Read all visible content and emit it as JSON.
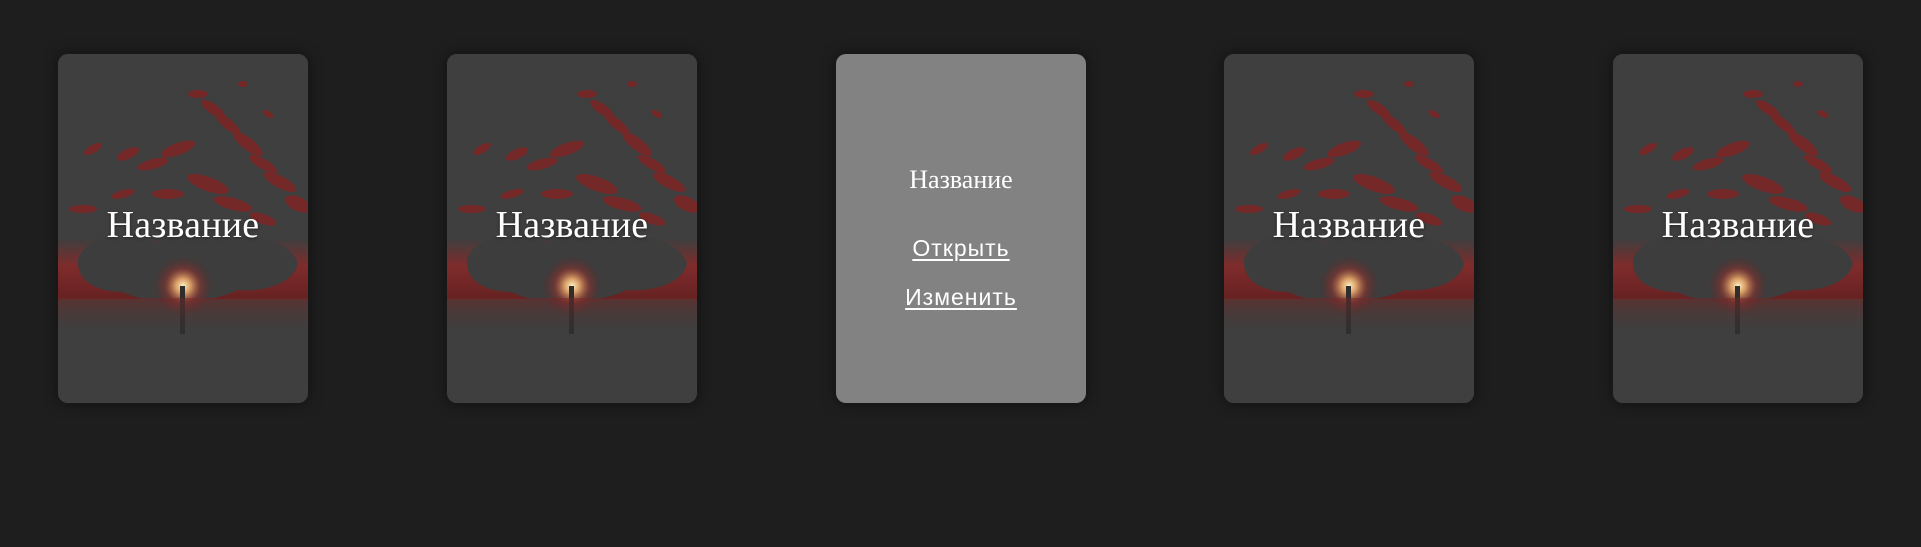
{
  "colors": {
    "page_background": "#1e1e1e",
    "card_background": "#3f3f3f",
    "card_active_background": "#828282",
    "card_art_red": "#8e2222",
    "text": "#ffffff"
  },
  "cards": [
    {
      "title": "Название",
      "state": "default",
      "image": "red-tree-sunset-image"
    },
    {
      "title": "Название",
      "state": "default",
      "image": "red-tree-sunset-image"
    },
    {
      "title": "Название",
      "state": "hovered",
      "open_label": "Открыть",
      "edit_label": "Изменить"
    },
    {
      "title": "Название",
      "state": "default",
      "image": "red-tree-sunset-image"
    },
    {
      "title": "Название",
      "state": "default",
      "image": "red-tree-sunset-image"
    }
  ]
}
